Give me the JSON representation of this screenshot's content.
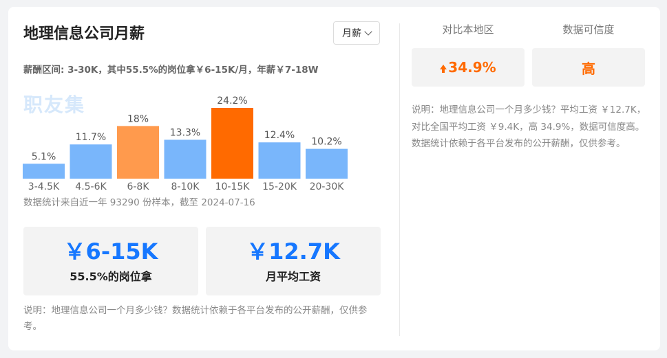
{
  "header": {
    "title": "地理信息公司月薪",
    "period_select": "月薪"
  },
  "summary": {
    "range_text": "薪酬区间: 3-30K，其中55.5%的岗位拿￥6-15K/月，年薪￥7-18W"
  },
  "watermark": "职友集",
  "chart_data": {
    "type": "bar",
    "categories": [
      "3-4.5K",
      "4.5-6K",
      "6-8K",
      "8-10K",
      "10-15K",
      "15-20K",
      "20-30K"
    ],
    "values": [
      5.1,
      11.7,
      18,
      13.3,
      24.2,
      12.4,
      10.2
    ],
    "value_labels": [
      "5.1%",
      "11.7%",
      "18%",
      "13.3%",
      "24.2%",
      "12.4%",
      "10.2%"
    ],
    "ylim": [
      0,
      24.2
    ],
    "grid": false,
    "colors": [
      "#79b6fb",
      "#79b6fb",
      "#ff9a4d",
      "#79b6fb",
      "#ff6a00",
      "#79b6fb",
      "#79b6fb"
    ]
  },
  "source_note": "数据统计来自近一年 93290 份样本，截至 2024-07-16",
  "stats": [
    {
      "value": "￥6-15K",
      "label": "55.5%的岗位拿"
    },
    {
      "value": "￥12.7K",
      "label": "月平均工资"
    }
  ],
  "left_note": "说明：地理信息公司一个月多少钱？数据统计依赖于各平台发布的公开薪酬，仅供参考。",
  "comparison": {
    "local_header": "对比本地区",
    "local_value": "34.9%",
    "credibility_header": "数据可信度",
    "credibility_value": "高",
    "note": "说明：地理信息公司一个月多少钱？平均工资 ￥12.7K，对比全国平均工资 ￥9.4K，高 34.9%，数据可信度高。数据统计依赖于各平台发布的公开薪酬，仅供参考。"
  },
  "colors": {
    "accent_blue": "#1677ff",
    "accent_orange": "#ff6a00",
    "bar_blue": "#79b6fb"
  }
}
